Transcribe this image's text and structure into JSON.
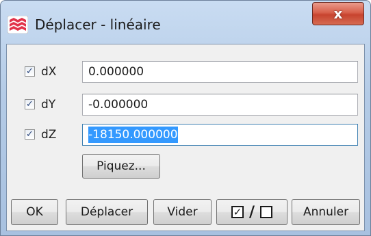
{
  "window": {
    "title": "Déplacer - linéaire",
    "close_label": "x"
  },
  "fields": [
    {
      "label": "dX",
      "checked": true,
      "value": "0.000000"
    },
    {
      "label": "dY",
      "checked": true,
      "value": "-0.000000"
    },
    {
      "label": "dZ",
      "checked": true,
      "value": "-18150.000000",
      "selected": true
    }
  ],
  "pick_button": "Piquez...",
  "buttons": {
    "ok": "OK",
    "move": "Déplacer",
    "clear": "Vider",
    "cancel": "Annuler"
  },
  "toggle_all": {
    "check_glyph": "✓",
    "separator": "/"
  },
  "checkbox_glyph": "✓",
  "colors": {
    "selection": "#3399ff",
    "close_button": "#c7442f"
  }
}
